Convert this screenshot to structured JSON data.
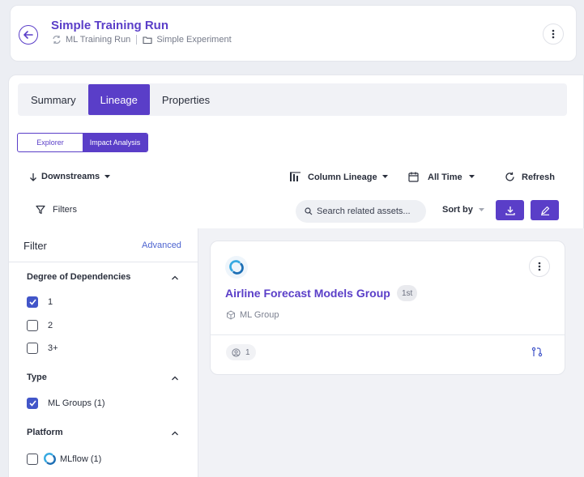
{
  "header": {
    "title": "Simple Training Run",
    "breadcrumb": [
      {
        "icon": "sync-icon",
        "label": "ML Training Run"
      },
      {
        "icon": "folder-icon",
        "label": "Simple Experiment"
      }
    ]
  },
  "tabs": [
    {
      "label": "Summary",
      "active": false
    },
    {
      "label": "Lineage",
      "active": true
    },
    {
      "label": "Properties",
      "active": false
    }
  ],
  "mode_toggle": {
    "options": [
      "Explorer",
      "Impact Analysis"
    ],
    "selected": "Impact Analysis"
  },
  "toolbar": {
    "direction": "Downstreams",
    "column_lineage": "Column Lineage",
    "time_range": "All Time",
    "refresh": "Refresh",
    "filters": "Filters",
    "search_placeholder": "Search related assets...",
    "sort_by": "Sort by"
  },
  "filter_panel": {
    "title": "Filter",
    "advanced": "Advanced",
    "sections": [
      {
        "title": "Degree of Dependencies",
        "options": [
          {
            "label": "1",
            "checked": true
          },
          {
            "label": "2",
            "checked": false
          },
          {
            "label": "3+",
            "checked": false
          }
        ]
      },
      {
        "title": "Type",
        "options": [
          {
            "label": "ML Groups (1)",
            "checked": true
          }
        ]
      },
      {
        "title": "Platform",
        "options": [
          {
            "label": "MLflow (1)",
            "checked": false,
            "icon": "mlflow-icon"
          }
        ]
      }
    ]
  },
  "results": [
    {
      "name": "Airline Forecast Models Group",
      "degree": "1st",
      "type": "ML Group",
      "platform_icon": "mlflow-icon",
      "count": "1"
    }
  ],
  "colors": {
    "accent": "#5a3ec8",
    "checkbox": "#4256c9",
    "link": "#4d64d0"
  }
}
